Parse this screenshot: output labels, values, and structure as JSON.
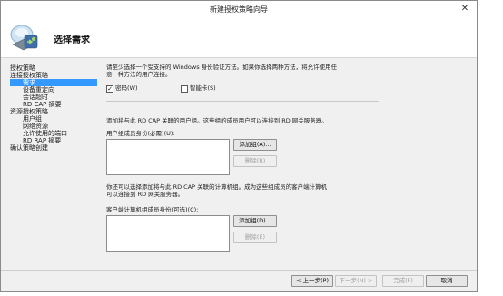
{
  "window": {
    "title": "新建授权策略向导",
    "close_glyph": "✕"
  },
  "header": {
    "title": "选择需求",
    "icon": "network-policy-wizard-icon"
  },
  "nav": [
    {
      "label": "授权策略"
    },
    {
      "label": "连接授权策略"
    },
    {
      "label": "需求"
    },
    {
      "label": "设备重定向"
    },
    {
      "label": "会话超时"
    },
    {
      "label": "RD CAP 摘要"
    },
    {
      "label": "资源授权策略"
    },
    {
      "label": "用户组"
    },
    {
      "label": "网络资源"
    },
    {
      "label": "允许使用的端口"
    },
    {
      "label": "RD RAP 摘要"
    },
    {
      "label": "确认策略创建"
    }
  ],
  "auth": {
    "intro_line1": "请至少选择一个受支持的 Windows 身份验证方法。如果你选择两种方法，将允许使用任",
    "intro_line2": "意一种方法的用户连接。",
    "password_label": "密码(W)",
    "password_checked": true,
    "password_mark": "✓",
    "smartcard_label": "智能卡(S)",
    "smartcard_checked": false
  },
  "user_groups": {
    "desc": "添加将与此 RD CAP 关联的用户组。这些组的成员用户可以连接到 RD 网关服务器。",
    "label": "用户组成员身份(必需)(U):",
    "add_button": "添加组(A)...",
    "remove_button": "删除(R)"
  },
  "computer_groups": {
    "desc_line1": "你还可以选择添加将与此 RD CAP 关联的计算机组。成为这些组成员的客户端计算机",
    "desc_line2": "可以连接到 RD 网关服务器。",
    "label": "客户端计算机组成员身份(可选)(C):",
    "add_button": "添加组(D)...",
    "remove_button": "删除(E)"
  },
  "footer": {
    "back": "< 上一步(P)",
    "next": "下一步(N) >",
    "finish": "完成(F)",
    "cancel": "取消"
  }
}
